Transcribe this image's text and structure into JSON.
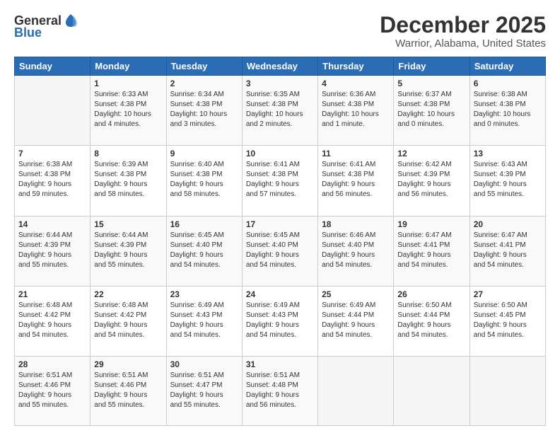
{
  "logo": {
    "line1": "General",
    "line2": "Blue"
  },
  "title": "December 2025",
  "subtitle": "Warrior, Alabama, United States",
  "header_days": [
    "Sunday",
    "Monday",
    "Tuesday",
    "Wednesday",
    "Thursday",
    "Friday",
    "Saturday"
  ],
  "weeks": [
    [
      {
        "day": "",
        "info": ""
      },
      {
        "day": "1",
        "info": "Sunrise: 6:33 AM\nSunset: 4:38 PM\nDaylight: 10 hours\nand 4 minutes."
      },
      {
        "day": "2",
        "info": "Sunrise: 6:34 AM\nSunset: 4:38 PM\nDaylight: 10 hours\nand 3 minutes."
      },
      {
        "day": "3",
        "info": "Sunrise: 6:35 AM\nSunset: 4:38 PM\nDaylight: 10 hours\nand 2 minutes."
      },
      {
        "day": "4",
        "info": "Sunrise: 6:36 AM\nSunset: 4:38 PM\nDaylight: 10 hours\nand 1 minute."
      },
      {
        "day": "5",
        "info": "Sunrise: 6:37 AM\nSunset: 4:38 PM\nDaylight: 10 hours\nand 0 minutes."
      },
      {
        "day": "6",
        "info": "Sunrise: 6:38 AM\nSunset: 4:38 PM\nDaylight: 10 hours\nand 0 minutes."
      }
    ],
    [
      {
        "day": "7",
        "info": "Sunrise: 6:38 AM\nSunset: 4:38 PM\nDaylight: 9 hours\nand 59 minutes."
      },
      {
        "day": "8",
        "info": "Sunrise: 6:39 AM\nSunset: 4:38 PM\nDaylight: 9 hours\nand 58 minutes."
      },
      {
        "day": "9",
        "info": "Sunrise: 6:40 AM\nSunset: 4:38 PM\nDaylight: 9 hours\nand 58 minutes."
      },
      {
        "day": "10",
        "info": "Sunrise: 6:41 AM\nSunset: 4:38 PM\nDaylight: 9 hours\nand 57 minutes."
      },
      {
        "day": "11",
        "info": "Sunrise: 6:41 AM\nSunset: 4:38 PM\nDaylight: 9 hours\nand 56 minutes."
      },
      {
        "day": "12",
        "info": "Sunrise: 6:42 AM\nSunset: 4:39 PM\nDaylight: 9 hours\nand 56 minutes."
      },
      {
        "day": "13",
        "info": "Sunrise: 6:43 AM\nSunset: 4:39 PM\nDaylight: 9 hours\nand 55 minutes."
      }
    ],
    [
      {
        "day": "14",
        "info": "Sunrise: 6:44 AM\nSunset: 4:39 PM\nDaylight: 9 hours\nand 55 minutes."
      },
      {
        "day": "15",
        "info": "Sunrise: 6:44 AM\nSunset: 4:39 PM\nDaylight: 9 hours\nand 55 minutes."
      },
      {
        "day": "16",
        "info": "Sunrise: 6:45 AM\nSunset: 4:40 PM\nDaylight: 9 hours\nand 54 minutes."
      },
      {
        "day": "17",
        "info": "Sunrise: 6:45 AM\nSunset: 4:40 PM\nDaylight: 9 hours\nand 54 minutes."
      },
      {
        "day": "18",
        "info": "Sunrise: 6:46 AM\nSunset: 4:40 PM\nDaylight: 9 hours\nand 54 minutes."
      },
      {
        "day": "19",
        "info": "Sunrise: 6:47 AM\nSunset: 4:41 PM\nDaylight: 9 hours\nand 54 minutes."
      },
      {
        "day": "20",
        "info": "Sunrise: 6:47 AM\nSunset: 4:41 PM\nDaylight: 9 hours\nand 54 minutes."
      }
    ],
    [
      {
        "day": "21",
        "info": "Sunrise: 6:48 AM\nSunset: 4:42 PM\nDaylight: 9 hours\nand 54 minutes."
      },
      {
        "day": "22",
        "info": "Sunrise: 6:48 AM\nSunset: 4:42 PM\nDaylight: 9 hours\nand 54 minutes."
      },
      {
        "day": "23",
        "info": "Sunrise: 6:49 AM\nSunset: 4:43 PM\nDaylight: 9 hours\nand 54 minutes."
      },
      {
        "day": "24",
        "info": "Sunrise: 6:49 AM\nSunset: 4:43 PM\nDaylight: 9 hours\nand 54 minutes."
      },
      {
        "day": "25",
        "info": "Sunrise: 6:49 AM\nSunset: 4:44 PM\nDaylight: 9 hours\nand 54 minutes."
      },
      {
        "day": "26",
        "info": "Sunrise: 6:50 AM\nSunset: 4:44 PM\nDaylight: 9 hours\nand 54 minutes."
      },
      {
        "day": "27",
        "info": "Sunrise: 6:50 AM\nSunset: 4:45 PM\nDaylight: 9 hours\nand 54 minutes."
      }
    ],
    [
      {
        "day": "28",
        "info": "Sunrise: 6:51 AM\nSunset: 4:46 PM\nDaylight: 9 hours\nand 55 minutes."
      },
      {
        "day": "29",
        "info": "Sunrise: 6:51 AM\nSunset: 4:46 PM\nDaylight: 9 hours\nand 55 minutes."
      },
      {
        "day": "30",
        "info": "Sunrise: 6:51 AM\nSunset: 4:47 PM\nDaylight: 9 hours\nand 55 minutes."
      },
      {
        "day": "31",
        "info": "Sunrise: 6:51 AM\nSunset: 4:48 PM\nDaylight: 9 hours\nand 56 minutes."
      },
      {
        "day": "",
        "info": ""
      },
      {
        "day": "",
        "info": ""
      },
      {
        "day": "",
        "info": ""
      }
    ]
  ]
}
